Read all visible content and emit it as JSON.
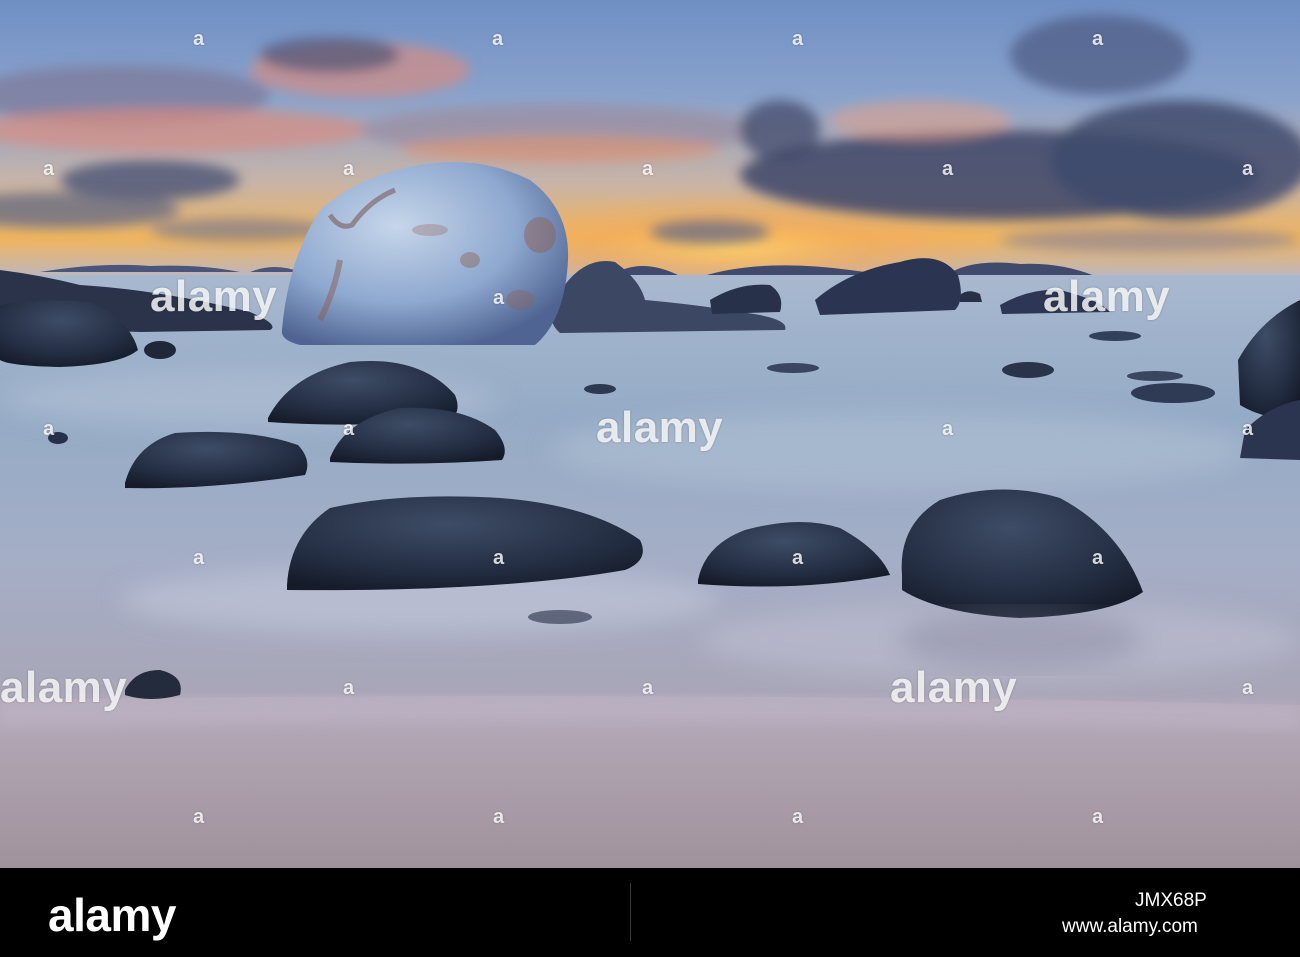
{
  "image": {
    "description_tags": [
      "sea",
      "boulders",
      "sunset",
      "long-exposure"
    ],
    "palette": {
      "sky_top": "#6d8fc6",
      "sky_glow": "#f2b25a",
      "cloud_pink": "#d9857a",
      "cloud_dark": "#3d4766",
      "sea": "#9fb3cc",
      "sand": "#a79fae",
      "rock_dark": "#20293b",
      "rock_light": "#9fb6d8"
    }
  },
  "watermarks": {
    "text": "alamy",
    "mark": "a"
  },
  "footer": {
    "logo": "alamy",
    "image_id": "JMX68P",
    "url": "www.alamy.com"
  }
}
